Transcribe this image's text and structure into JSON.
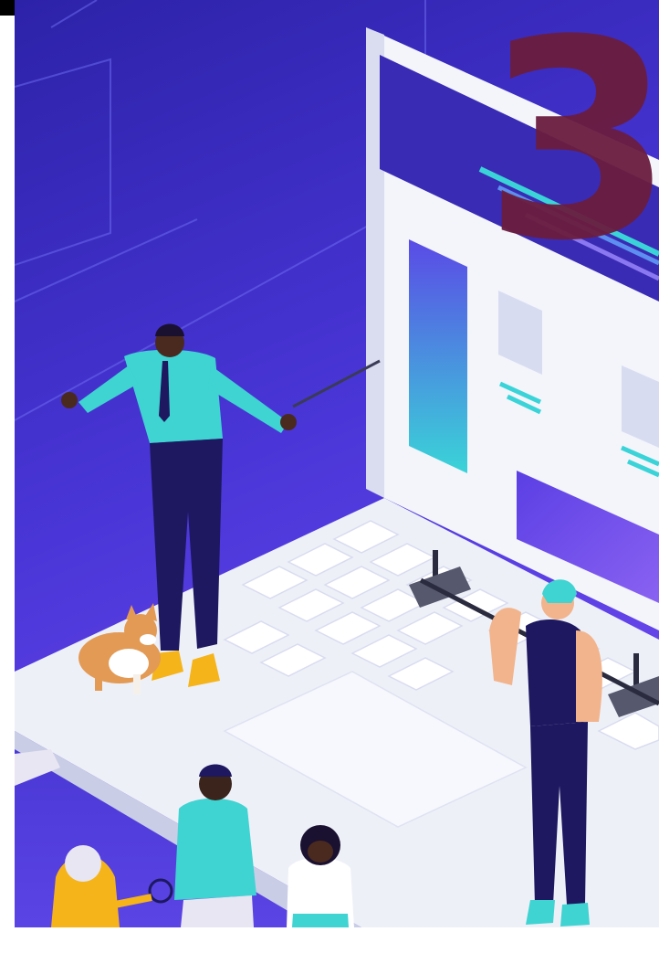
{
  "image": {
    "badge_number": "3",
    "colors": {
      "background_top": "#3a2fc4",
      "background_bottom": "#5a3ee6",
      "platform": "#eef0f8",
      "platform_shadow": "#c9cde6",
      "screen_frame": "#f3f5fb",
      "screen_header": "#3a2bb5",
      "accent_cyan": "#3ad4d8",
      "accent_purple": "#6a4ee0",
      "badge": "#6b1d3f",
      "shirt_teal": "#3fd3d2",
      "pants_navy": "#1d1860",
      "skin_dark": "#4a2a1e",
      "skin_light": "#f2b48c",
      "shoe_yellow": "#f5b41a",
      "dog_orange": "#e39a55"
    },
    "icons": [
      "person-presenter-icon",
      "person-lifter-icon",
      "dog-icon",
      "laptop-icon",
      "crowd-icon"
    ]
  }
}
